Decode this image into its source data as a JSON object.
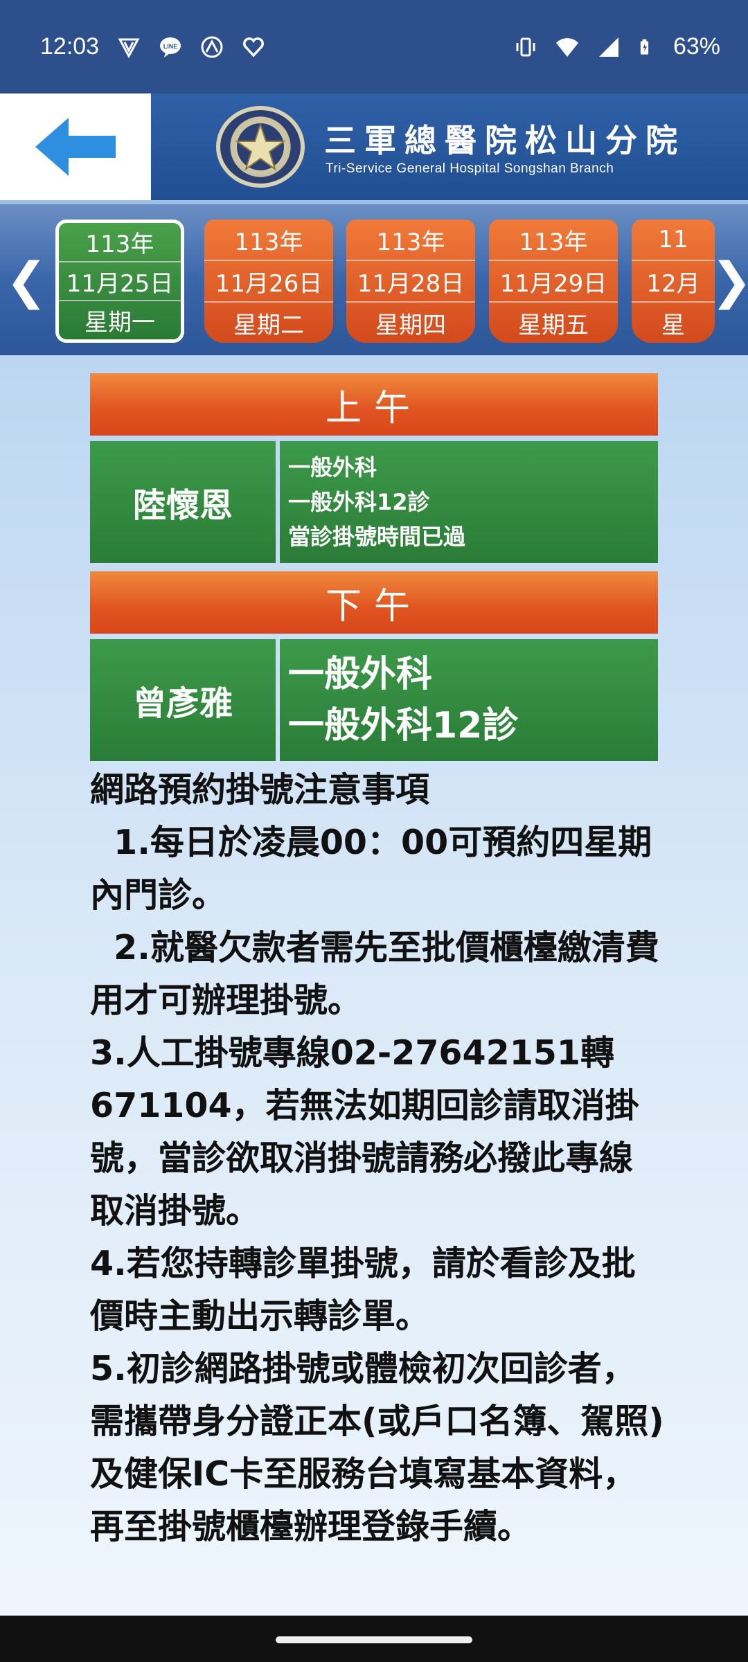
{
  "status_bar": {
    "time": "12:03",
    "battery": "63%",
    "icons_left": [
      "v-shield-icon",
      "line-icon",
      "app-icon",
      "heart-icon"
    ],
    "icons_right": [
      "vibrate-icon",
      "wifi-icon",
      "signal-icon",
      "battery-icon"
    ]
  },
  "header": {
    "hospital_name": "三軍總醫院松山分院",
    "hospital_name_en": "Tri-Service General Hospital Songshan Branch"
  },
  "dates": [
    {
      "year": "113年",
      "date": "11月25日",
      "weekday": "星期一",
      "selected": true
    },
    {
      "year": "113年",
      "date": "11月26日",
      "weekday": "星期二",
      "selected": false
    },
    {
      "year": "113年",
      "date": "11月28日",
      "weekday": "星期四",
      "selected": false
    },
    {
      "year": "113年",
      "date": "11月29日",
      "weekday": "星期五",
      "selected": false
    },
    {
      "year": "11",
      "date": "12月",
      "weekday": "星",
      "selected": false
    }
  ],
  "morning": {
    "label": "上午",
    "doctor": "陸懷恩",
    "dept": "一般外科",
    "room": "一般外科12診",
    "status": "當診掛號時間已過"
  },
  "afternoon": {
    "label": "下午",
    "doctor": "曾彥雅",
    "dept": "一般外科",
    "room": "一般外科12診"
  },
  "notes": {
    "title": "網路預約掛號注意事項",
    "items": [
      "  1.每日於凌晨00：00可預約四星期內門診。",
      "  2.就醫欠款者需先至批價櫃檯繳清費用才可辦理掛號。",
      "3.人工掛號專線02-27642151轉671104，若無法如期回診請取消掛號，當診欲取消掛號請務必撥此專線取消掛號。",
      "4.若您持轉診單掛號，請於看診及批價時主動出示轉診單。",
      "5.初診網路掛號或體檢初次回診者，需攜帶身分證正本(或戶口名簿、駕照)及健保IC卡至服務台填寫基本資料，再至掛號櫃檯辦理登錄手續。"
    ]
  }
}
